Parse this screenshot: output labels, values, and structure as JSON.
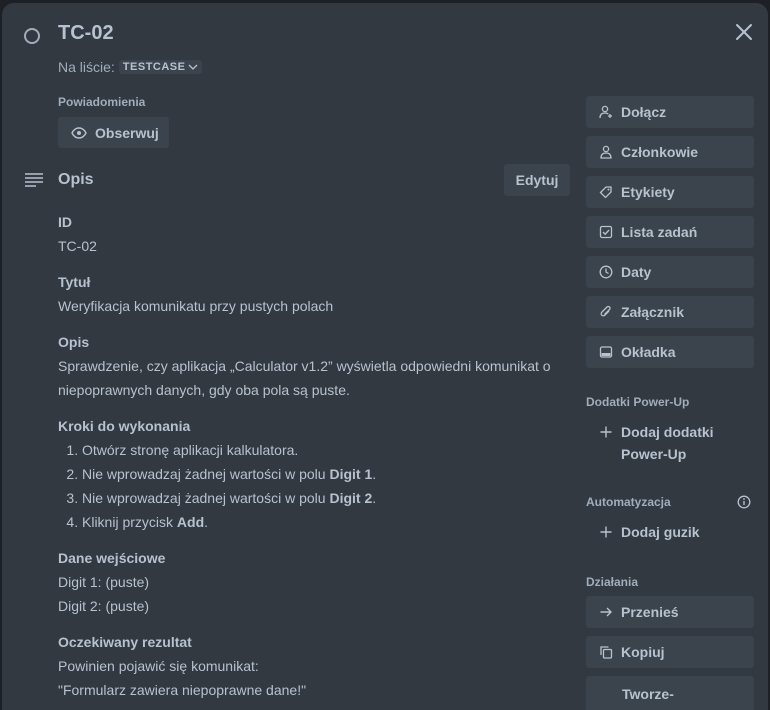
{
  "card": {
    "title": "TC-02",
    "list_prefix": "Na liście:",
    "list_name": "TESTCASE"
  },
  "notifications": {
    "label": "Powiadomienia",
    "watch_label": "Obserwuj"
  },
  "description": {
    "heading": "Opis",
    "edit_label": "Edytuj",
    "id_heading": "ID",
    "id_value": "TC-02",
    "title_heading": "Tytuł",
    "title_value": "Weryfikacja komunikatu przy pustych polach",
    "desc_heading": "Opis",
    "desc_value": "Sprawdzenie, czy aplikacja „Calculator v1.2” wyświetla odpowiedni komunikat o niepoprawnych danych, gdy oba pola są puste.",
    "steps_heading": "Kroki do wykonania",
    "step1": "Otwórz stronę aplikacji kalkulatora.",
    "step2_pre": "Nie wprowadzaj żadnej wartości w polu ",
    "step2_bold": "Digit 1",
    "step3_pre": "Nie wprowadzaj żadnej wartości w polu ",
    "step3_bold": "Digit 2",
    "step4_pre": "Kliknij przycisk ",
    "step4_bold": "Add",
    "period": ".",
    "input_heading": "Dane wejściowe",
    "input1": "Digit 1: (puste)",
    "input2": "Digit 2: (puste)",
    "expected_heading": "Oczekiwany rezultat",
    "expected1": "Powinien pojawić się komunikat:",
    "expected2": "\"Formularz zawiera niepoprawne dane!\""
  },
  "sidebar": {
    "join": "Dołącz",
    "members": "Członkowie",
    "labels": "Etykiety",
    "checklist": "Lista zadań",
    "dates": "Daty",
    "attachment": "Załącznik",
    "cover": "Okładka",
    "powerups_label": "Dodatki Power-Up",
    "add_powerups": "Dodaj dodatki Power-Up",
    "automation_label": "Automatyzacja",
    "add_button": "Dodaj guzik",
    "actions_label": "Działania",
    "move": "Przenieś",
    "copy": "Kopiuj",
    "template": "Tworze- nie kopii"
  },
  "colors": {
    "modal_bg": "#323940",
    "button_bg": "#3b444c",
    "text": "#b6c2cf",
    "subtle_text": "#9fadbc"
  }
}
